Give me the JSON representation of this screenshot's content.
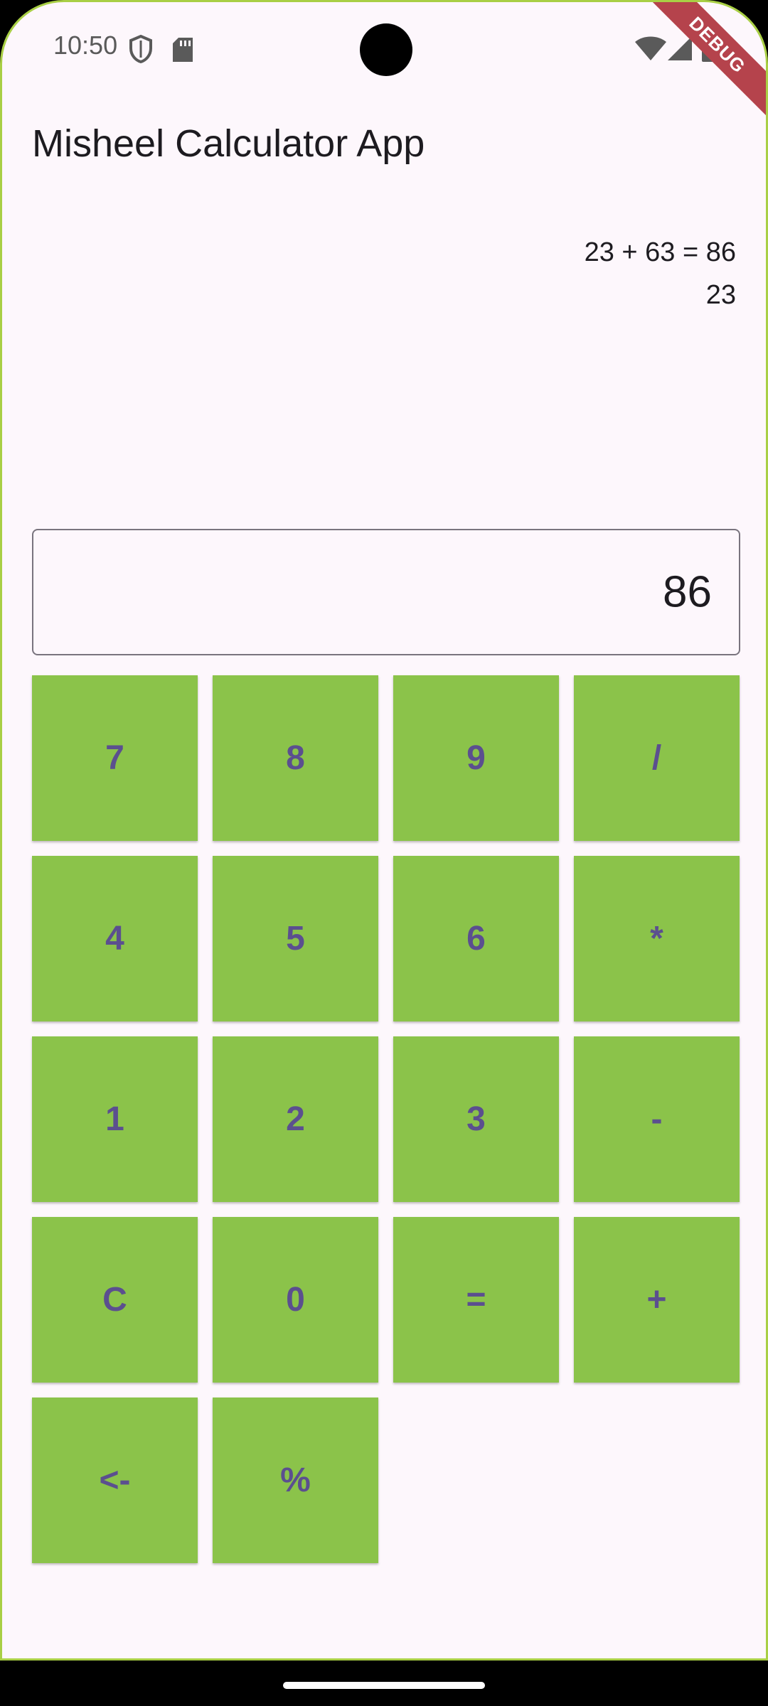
{
  "status_bar": {
    "time": "10:50",
    "icons": [
      "shield-icon",
      "sd-card-icon",
      "wifi-icon",
      "signal-icon",
      "battery-icon"
    ]
  },
  "debug_banner": "DEBUG",
  "app": {
    "title": "Misheel Calculator App"
  },
  "history": [
    "23 + 63 = 86",
    "23"
  ],
  "display": {
    "value": "86"
  },
  "keys": [
    {
      "label": "7",
      "name": "key-7"
    },
    {
      "label": "8",
      "name": "key-8"
    },
    {
      "label": "9",
      "name": "key-9"
    },
    {
      "label": "/",
      "name": "key-divide"
    },
    {
      "label": "4",
      "name": "key-4"
    },
    {
      "label": "5",
      "name": "key-5"
    },
    {
      "label": "6",
      "name": "key-6"
    },
    {
      "label": "*",
      "name": "key-multiply"
    },
    {
      "label": "1",
      "name": "key-1"
    },
    {
      "label": "2",
      "name": "key-2"
    },
    {
      "label": "3",
      "name": "key-3"
    },
    {
      "label": "-",
      "name": "key-subtract"
    },
    {
      "label": "C",
      "name": "key-clear"
    },
    {
      "label": "0",
      "name": "key-0"
    },
    {
      "label": "=",
      "name": "key-equals"
    },
    {
      "label": "+",
      "name": "key-add"
    },
    {
      "label": "<-",
      "name": "key-backspace"
    },
    {
      "label": "%",
      "name": "key-percent"
    }
  ],
  "colors": {
    "background": "#fdf7fc",
    "key_background": "#8bc34a",
    "key_text": "#5b4f8f",
    "frame_border": "#a9cf45",
    "debug_ribbon": "#b5434c"
  }
}
